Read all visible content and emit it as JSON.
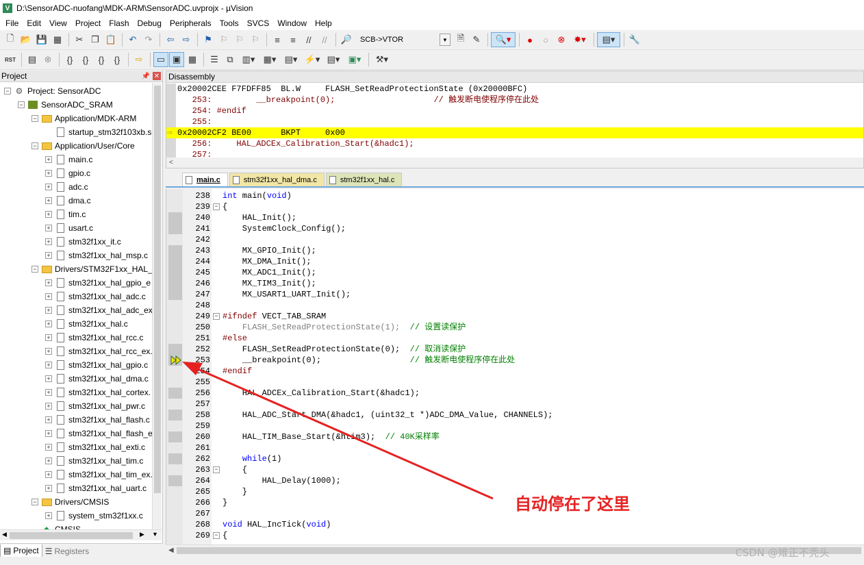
{
  "window": {
    "title": "D:\\SensorADC-nuofang\\MDK-ARM\\SensorADC.uvprojx - µVision",
    "app_icon": "V"
  },
  "menu": [
    "File",
    "Edit",
    "View",
    "Project",
    "Flash",
    "Debug",
    "Peripherals",
    "Tools",
    "SVCS",
    "Window",
    "Help"
  ],
  "toolbar1": {
    "combo_value": "SCB->VTOR"
  },
  "toolbar2": {
    "rst_label": "RST"
  },
  "project_panel": {
    "title": "Project",
    "tree": [
      {
        "label": "Project: SensorADC",
        "indent": 0,
        "exp": "−",
        "icon": "project"
      },
      {
        "label": "SensorADC_SRAM",
        "indent": 1,
        "exp": "−",
        "icon": "target"
      },
      {
        "label": "Application/MDK-ARM",
        "indent": 2,
        "exp": "−",
        "icon": "folder"
      },
      {
        "label": "startup_stm32f103xb.s",
        "indent": 3,
        "exp": "",
        "icon": "file"
      },
      {
        "label": "Application/User/Core",
        "indent": 2,
        "exp": "−",
        "icon": "folder"
      },
      {
        "label": "main.c",
        "indent": 3,
        "exp": "+",
        "icon": "file"
      },
      {
        "label": "gpio.c",
        "indent": 3,
        "exp": "+",
        "icon": "file"
      },
      {
        "label": "adc.c",
        "indent": 3,
        "exp": "+",
        "icon": "file"
      },
      {
        "label": "dma.c",
        "indent": 3,
        "exp": "+",
        "icon": "file"
      },
      {
        "label": "tim.c",
        "indent": 3,
        "exp": "+",
        "icon": "file"
      },
      {
        "label": "usart.c",
        "indent": 3,
        "exp": "+",
        "icon": "file"
      },
      {
        "label": "stm32f1xx_it.c",
        "indent": 3,
        "exp": "+",
        "icon": "file"
      },
      {
        "label": "stm32f1xx_hal_msp.c",
        "indent": 3,
        "exp": "+",
        "icon": "file"
      },
      {
        "label": "Drivers/STM32F1xx_HAL_I",
        "indent": 2,
        "exp": "−",
        "icon": "folder"
      },
      {
        "label": "stm32f1xx_hal_gpio_e",
        "indent": 3,
        "exp": "+",
        "icon": "file"
      },
      {
        "label": "stm32f1xx_hal_adc.c",
        "indent": 3,
        "exp": "+",
        "icon": "file"
      },
      {
        "label": "stm32f1xx_hal_adc_ex",
        "indent": 3,
        "exp": "+",
        "icon": "file"
      },
      {
        "label": "stm32f1xx_hal.c",
        "indent": 3,
        "exp": "+",
        "icon": "file"
      },
      {
        "label": "stm32f1xx_hal_rcc.c",
        "indent": 3,
        "exp": "+",
        "icon": "file"
      },
      {
        "label": "stm32f1xx_hal_rcc_ex.",
        "indent": 3,
        "exp": "+",
        "icon": "file"
      },
      {
        "label": "stm32f1xx_hal_gpio.c",
        "indent": 3,
        "exp": "+",
        "icon": "file"
      },
      {
        "label": "stm32f1xx_hal_dma.c",
        "indent": 3,
        "exp": "+",
        "icon": "file"
      },
      {
        "label": "stm32f1xx_hal_cortex.",
        "indent": 3,
        "exp": "+",
        "icon": "file"
      },
      {
        "label": "stm32f1xx_hal_pwr.c",
        "indent": 3,
        "exp": "+",
        "icon": "file"
      },
      {
        "label": "stm32f1xx_hal_flash.c",
        "indent": 3,
        "exp": "+",
        "icon": "file"
      },
      {
        "label": "stm32f1xx_hal_flash_e",
        "indent": 3,
        "exp": "+",
        "icon": "file"
      },
      {
        "label": "stm32f1xx_hal_exti.c",
        "indent": 3,
        "exp": "+",
        "icon": "file"
      },
      {
        "label": "stm32f1xx_hal_tim.c",
        "indent": 3,
        "exp": "+",
        "icon": "file"
      },
      {
        "label": "stm32f1xx_hal_tim_ex.",
        "indent": 3,
        "exp": "+",
        "icon": "file"
      },
      {
        "label": "stm32f1xx_hal_uart.c",
        "indent": 3,
        "exp": "+",
        "icon": "file"
      },
      {
        "label": "Drivers/CMSIS",
        "indent": 2,
        "exp": "−",
        "icon": "folder"
      },
      {
        "label": "system_stm32f1xx.c",
        "indent": 3,
        "exp": "+",
        "icon": "file"
      },
      {
        "label": "CMSIS",
        "indent": 2,
        "exp": "",
        "icon": "cmsis"
      }
    ],
    "tabs": {
      "project": "Project",
      "registers": "Registers"
    }
  },
  "disassembly": {
    "title": "Disassembly",
    "lines": [
      {
        "text": "0x20002CEE F7FDFF85  BL.W     FLASH_SetReadProtectionState (0x20000BFC)",
        "kind": "asm"
      },
      {
        "text": "   253:         __breakpoint(0);                    // 触发断电使程序停在此处",
        "kind": "src"
      },
      {
        "text": "   254: #endif",
        "kind": "src"
      },
      {
        "text": "   255:",
        "kind": "src"
      },
      {
        "text": "0x20002CF2 BE00      BKPT     0x00",
        "kind": "current"
      },
      {
        "text": "   256:     HAL_ADCEx_Calibration_Start(&hadc1);",
        "kind": "src"
      },
      {
        "text": "   257:",
        "kind": "src"
      }
    ],
    "scroll_left": "<"
  },
  "editor": {
    "tabs": [
      {
        "label": "main.c",
        "state": "active"
      },
      {
        "label": "stm32f1xx_hal_dma.c",
        "state": "inactive"
      },
      {
        "label": "stm32f1xx_hal.c",
        "state": "inactive2"
      }
    ],
    "lines": [
      {
        "no": "238",
        "fold": "",
        "mark": false,
        "html": "<span class=\"kw\">int</span> main(<span class=\"kw\">void</span>)"
      },
      {
        "no": "239",
        "fold": "−",
        "mark": false,
        "html": "{"
      },
      {
        "no": "240",
        "fold": "",
        "mark": true,
        "html": "    HAL_Init();"
      },
      {
        "no": "241",
        "fold": "",
        "mark": true,
        "html": "    SystemClock_Config();"
      },
      {
        "no": "242",
        "fold": "",
        "mark": false,
        "html": ""
      },
      {
        "no": "243",
        "fold": "",
        "mark": true,
        "html": "    MX_GPIO_Init();"
      },
      {
        "no": "244",
        "fold": "",
        "mark": true,
        "html": "    MX_DMA_Init();"
      },
      {
        "no": "245",
        "fold": "",
        "mark": true,
        "html": "    MX_ADC1_Init();"
      },
      {
        "no": "246",
        "fold": "",
        "mark": true,
        "html": "    MX_TIM3_Init();"
      },
      {
        "no": "247",
        "fold": "",
        "mark": true,
        "html": "    MX_USART1_UART_Init();"
      },
      {
        "no": "248",
        "fold": "",
        "mark": false,
        "html": ""
      },
      {
        "no": "249",
        "fold": "−",
        "mark": false,
        "html": "<span class=\"pp\">#ifndef</span> VECT_TAB_SRAM"
      },
      {
        "no": "250",
        "fold": "",
        "mark": false,
        "html": "    <span class=\"dim\">FLASH_SetReadProtectionState(1);  </span><span class=\"cm\">// 设置读保护</span>"
      },
      {
        "no": "251",
        "fold": "",
        "mark": false,
        "html": "<span class=\"pp\">#else</span>"
      },
      {
        "no": "252",
        "fold": "",
        "mark": true,
        "html": "    FLASH_SetReadProtectionState(0);  <span class=\"cm\">// 取消读保护</span>"
      },
      {
        "no": "253",
        "fold": "",
        "mark": true,
        "html": "    __breakpoint(0);                  <span class=\"cm\">// 触发断电使程序停在此处</span>"
      },
      {
        "no": "254",
        "fold": "",
        "mark": false,
        "html": "<span class=\"pp\">#endif</span>"
      },
      {
        "no": "255",
        "fold": "",
        "mark": false,
        "html": ""
      },
      {
        "no": "256",
        "fold": "",
        "mark": true,
        "html": "    HAL_ADCEx_Calibration_Start(&amp;hadc1);"
      },
      {
        "no": "257",
        "fold": "",
        "mark": false,
        "html": ""
      },
      {
        "no": "258",
        "fold": "",
        "mark": true,
        "html": "    HAL_ADC_Start_DMA(&amp;hadc1, (uint32_t *)ADC_DMA_Value, CHANNELS);"
      },
      {
        "no": "259",
        "fold": "",
        "mark": false,
        "html": ""
      },
      {
        "no": "260",
        "fold": "",
        "mark": true,
        "html": "    HAL_TIM_Base_Start(&amp;htim3);  <span class=\"cm\">// 40K采样率</span>"
      },
      {
        "no": "261",
        "fold": "",
        "mark": false,
        "html": ""
      },
      {
        "no": "262",
        "fold": "",
        "mark": true,
        "html": "    <span class=\"kw\">while</span>(1)"
      },
      {
        "no": "263",
        "fold": "−",
        "mark": false,
        "html": "    {"
      },
      {
        "no": "264",
        "fold": "",
        "mark": true,
        "html": "        HAL_Delay(1000);"
      },
      {
        "no": "265",
        "fold": "",
        "mark": false,
        "html": "    }"
      },
      {
        "no": "266",
        "fold": "",
        "mark": false,
        "html": "}"
      },
      {
        "no": "267",
        "fold": "",
        "mark": false,
        "html": ""
      },
      {
        "no": "268",
        "fold": "",
        "mark": false,
        "html": "<span class=\"kw\">void</span> HAL_IncTick(<span class=\"kw\">void</span>)"
      },
      {
        "no": "269",
        "fold": "−",
        "mark": false,
        "html": "{"
      }
    ]
  },
  "annotation": "自动停在了这里",
  "watermark": "CSDN @雉正不秃头",
  "colors": {
    "current_line": "#ffff00",
    "annotation": "#e52222",
    "keyword": "#0000ff",
    "comment": "#008000"
  }
}
